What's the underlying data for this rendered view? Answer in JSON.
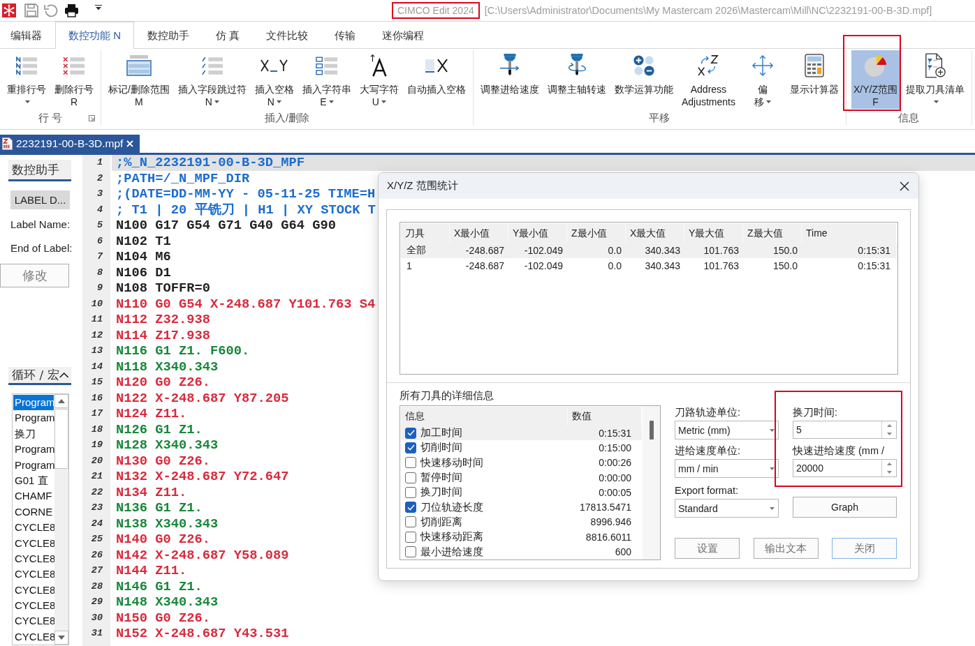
{
  "title_bar": {
    "app_name": "CIMCO Edit 2024",
    "highlighted": true,
    "file_path": "[C:\\Users\\Administrator\\Documents\\My Mastercam 2026\\Mastercam\\Mill\\NC\\2232191-00-B-3D.mpf]"
  },
  "ribbon_tabs": [
    {
      "label": "编辑器",
      "selected": false
    },
    {
      "label": "数控功能 N",
      "selected": true
    },
    {
      "label": "数控助手",
      "selected": false
    },
    {
      "label": "仿 真",
      "selected": false
    },
    {
      "label": "文件比较",
      "selected": false
    },
    {
      "label": "传输",
      "selected": false
    },
    {
      "label": "迷你编程",
      "selected": false
    }
  ],
  "ribbon_groups": [
    {
      "label": "行 号",
      "launcher": true,
      "buttons": [
        {
          "kind": "renumber",
          "label": "重排行号",
          "dropdown": true,
          "selected": false,
          "highlighted": false
        },
        {
          "kind": "delete-numbers",
          "label": "删除行号",
          "line2": "R",
          "dropdown": false,
          "selected": false,
          "highlighted": false
        }
      ]
    },
    {
      "label": "插入/删除",
      "launcher": false,
      "buttons": [
        {
          "kind": "mark-range",
          "label": "标记/删除范围",
          "line2": "M",
          "dropdown": false,
          "selected": false,
          "highlighted": false
        },
        {
          "kind": "skip-char",
          "label": "插入字段跳过符",
          "line2": "N",
          "dropdown": true,
          "selected": false,
          "highlighted": false
        },
        {
          "kind": "insert-space",
          "label": "插入空格",
          "line2": "N",
          "dropdown": true,
          "selected": false,
          "highlighted": false
        },
        {
          "kind": "insert-string",
          "label": "插入字符串",
          "line2": "E",
          "dropdown": true,
          "selected": false,
          "highlighted": false
        },
        {
          "kind": "uppercase",
          "label": "大写字符",
          "line2": "U",
          "dropdown": true,
          "selected": false,
          "highlighted": false
        },
        {
          "kind": "auto-space",
          "label": "自动插入空格",
          "dropdown": false,
          "selected": false,
          "highlighted": false
        }
      ]
    },
    {
      "label": "平移",
      "launcher": false,
      "buttons": [
        {
          "kind": "feed",
          "label": "调整进给速度",
          "dropdown": false,
          "selected": false,
          "highlighted": false
        },
        {
          "kind": "spindle",
          "label": "调整主轴转速",
          "dropdown": false,
          "selected": false,
          "highlighted": false
        },
        {
          "kind": "math",
          "label": "数学运算功能",
          "dropdown": false,
          "selected": false,
          "highlighted": false
        },
        {
          "kind": "address",
          "label": "Address",
          "line2": "Adjustments",
          "dropdown": false,
          "selected": false,
          "highlighted": false
        },
        {
          "kind": "offset",
          "label": "偏",
          "line2": "移",
          "dropdown": true,
          "selected": false,
          "highlighted": false
        },
        {
          "kind": "calculator",
          "label": "显示计算器",
          "dropdown": false,
          "selected": false,
          "highlighted": false
        }
      ]
    },
    {
      "label": "信息",
      "launcher": false,
      "buttons": [
        {
          "kind": "range",
          "label": "X/Y/Z范围",
          "line2": "F",
          "dropdown": false,
          "selected": true,
          "highlighted": true
        },
        {
          "kind": "tool-list",
          "label": "提取刀具清单",
          "dropdown": true,
          "selected": false,
          "highlighted": false
        }
      ]
    }
  ],
  "document_tabs": [
    {
      "label": "2232191-00-B-3D.mpf",
      "selected": true
    }
  ],
  "left_panel": {
    "assistant": {
      "header": "数控助手",
      "label_button": "LABEL D...",
      "field_labels": [
        "Label Name:",
        "End of Label:"
      ],
      "modify_button": "修改"
    },
    "cycles": {
      "header": "循环 / 宏",
      "items": [
        {
          "label": "Program",
          "selected": true
        },
        {
          "label": "Program",
          "selected": false
        },
        {
          "label": "换刀",
          "selected": false
        },
        {
          "label": "Program",
          "selected": false
        },
        {
          "label": "Program",
          "selected": false
        },
        {
          "label": "G01 直",
          "selected": false
        },
        {
          "label": "CHAMF",
          "selected": false
        },
        {
          "label": "CORNE",
          "selected": false
        },
        {
          "label": "CYCLE8",
          "selected": false
        },
        {
          "label": "CYCLE8",
          "selected": false
        },
        {
          "label": "CYCLE8",
          "selected": false
        },
        {
          "label": "CYCLE8",
          "selected": false
        },
        {
          "label": "CYCLE8",
          "selected": false
        },
        {
          "label": "CYCLE8",
          "selected": false
        },
        {
          "label": "CYCLE8",
          "selected": false
        },
        {
          "label": "CYCLE8",
          "selected": false
        }
      ]
    }
  },
  "editor": {
    "lines": [
      {
        "number": "1",
        "text": ";%_N_2232191-00-B-3D_MPF",
        "kind": "comment",
        "current": true
      },
      {
        "number": "2",
        "text": ";PATH=/_N_MPF_DIR",
        "kind": "comment",
        "current": false
      },
      {
        "number": "3",
        "text": ";(DATE=DD-MM-YY - 05-11-25 TIME=H",
        "kind": "comment",
        "current": false
      },
      {
        "number": "4",
        "text": "; T1 | 20 平铣刀 | H1 | XY STOCK T",
        "kind": "comment",
        "current": false
      },
      {
        "number": "5",
        "text": "N100 G17 G54 G71 G40 G64 G90",
        "kind": "plain",
        "current": false
      },
      {
        "number": "6",
        "text": "N102 T1",
        "kind": "plain",
        "current": false
      },
      {
        "number": "7",
        "text": "N104 M6",
        "kind": "plain",
        "current": false
      },
      {
        "number": "8",
        "text": "N106 D1",
        "kind": "plain",
        "current": false
      },
      {
        "number": "9",
        "text": "N108 TOFFR=0",
        "kind": "plain",
        "current": false
      },
      {
        "number": "10",
        "text": "N110 G0 G54 X-248.687 Y101.763 S4",
        "kind": "rapid",
        "current": false
      },
      {
        "number": "11",
        "text": "N112 Z32.938",
        "kind": "rapid",
        "current": false
      },
      {
        "number": "12",
        "text": "N114 Z17.938",
        "kind": "rapid",
        "current": false
      },
      {
        "number": "13",
        "text": "N116 G1 Z1. F600.",
        "kind": "feed",
        "current": false
      },
      {
        "number": "14",
        "text": "N118 X340.343",
        "kind": "feed",
        "current": false
      },
      {
        "number": "15",
        "text": "N120 G0 Z26.",
        "kind": "rapid",
        "current": false
      },
      {
        "number": "16",
        "text": "N122 X-248.687 Y87.205",
        "kind": "rapid",
        "current": false
      },
      {
        "number": "17",
        "text": "N124 Z11.",
        "kind": "rapid",
        "current": false
      },
      {
        "number": "18",
        "text": "N126 G1 Z1.",
        "kind": "feed",
        "current": false
      },
      {
        "number": "19",
        "text": "N128 X340.343",
        "kind": "feed",
        "current": false
      },
      {
        "number": "20",
        "text": "N130 G0 Z26.",
        "kind": "rapid",
        "current": false
      },
      {
        "number": "21",
        "text": "N132 X-248.687 Y72.647",
        "kind": "rapid",
        "current": false
      },
      {
        "number": "22",
        "text": "N134 Z11.",
        "kind": "rapid",
        "current": false
      },
      {
        "number": "23",
        "text": "N136 G1 Z1.",
        "kind": "feed",
        "current": false
      },
      {
        "number": "24",
        "text": "N138 X340.343",
        "kind": "feed",
        "current": false
      },
      {
        "number": "25",
        "text": "N140 G0 Z26.",
        "kind": "rapid",
        "current": false
      },
      {
        "number": "26",
        "text": "N142 X-248.687 Y58.089",
        "kind": "rapid",
        "current": false
      },
      {
        "number": "27",
        "text": "N144 Z11.",
        "kind": "rapid",
        "current": false
      },
      {
        "number": "28",
        "text": "N146 G1 Z1.",
        "kind": "feed",
        "current": false
      },
      {
        "number": "29",
        "text": "N148 X340.343",
        "kind": "feed",
        "current": false
      },
      {
        "number": "30",
        "text": "N150 G0 Z26.",
        "kind": "rapid",
        "current": false
      },
      {
        "number": "31",
        "text": "N152 X-248.687 Y43.531",
        "kind": "rapid",
        "current": false
      }
    ]
  },
  "dialog": {
    "title": "X/Y/Z 范围统计",
    "range_table": {
      "columns": [
        "刀具",
        "X最小值",
        "Y最小值",
        "Z最小值",
        "X最大值",
        "Y最大值",
        "Z最大值",
        "Time"
      ],
      "rows": [
        {
          "cells": [
            "全部",
            "-248.687",
            "-102.049",
            "0.0",
            "340.343",
            "101.763",
            "150.0",
            "0:15:31"
          ],
          "selected": true
        },
        {
          "cells": [
            "1",
            "-248.687",
            "-102.049",
            "0.0",
            "340.343",
            "101.763",
            "150.0",
            "0:15:31"
          ],
          "selected": false
        }
      ]
    },
    "details": {
      "title": "所有刀具的详细信息",
      "columns": [
        "信息",
        "数值"
      ],
      "rows": [
        {
          "label": "加工时间",
          "value": "0:15:31",
          "checked": true,
          "selected": true
        },
        {
          "label": "切削时间",
          "value": "0:15:00",
          "checked": true,
          "selected": false
        },
        {
          "label": "快速移动时间",
          "value": "0:00:26",
          "checked": false,
          "selected": false
        },
        {
          "label": "暂停时间",
          "value": "0:00:00",
          "checked": false,
          "selected": false
        },
        {
          "label": "换刀时间",
          "value": "0:00:05",
          "checked": false,
          "selected": false
        },
        {
          "label": "刀位轨迹长度",
          "value": "17813.5471",
          "checked": true,
          "selected": false
        },
        {
          "label": "切削距离",
          "value": "8996.946",
          "checked": false,
          "selected": false
        },
        {
          "label": "快速移动距离",
          "value": "8816.6011",
          "checked": false,
          "selected": false
        },
        {
          "label": "最小进给速度",
          "value": "600",
          "checked": false,
          "selected": false
        }
      ]
    },
    "unit_fields": [
      {
        "label": "刀路轨迹单位:",
        "value": "Metric (mm)"
      },
      {
        "label": "进给速度单位:",
        "value": "mm / min"
      },
      {
        "label": "Export format:",
        "value": "Standard"
      }
    ],
    "tool_change_group": {
      "highlighted": true,
      "fields": [
        {
          "label": "换刀时间:",
          "value": "5"
        },
        {
          "label": "快速进给速度 (mm /",
          "value": "20000"
        }
      ]
    },
    "graph_button": "Graph",
    "buttons": [
      {
        "label": "设置",
        "default": false
      },
      {
        "label": "输出文本",
        "default": false
      },
      {
        "label": "关闭",
        "default": true
      }
    ]
  }
}
